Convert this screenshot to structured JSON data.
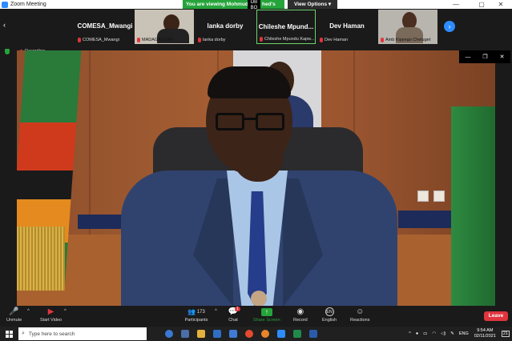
{
  "window": {
    "title": "Zoom Meeting",
    "controls": [
      "—",
      "▢",
      "✕"
    ]
  },
  "share_banner": {
    "viewing_left": "You are viewing Mohmud",
    "viewing_right": "hed's screen",
    "logo": "DB",
    "logo_bottom": "BO",
    "view_options": "View Options ▾"
  },
  "participants": [
    {
      "big": "COMESA_Mwangi",
      "small": "COMESA_Mwangi",
      "photo": false,
      "active": false
    },
    {
      "big": "",
      "small": "MADAGASCAR",
      "photo": true,
      "active": false
    },
    {
      "big": "lanka dorby",
      "small": "lanka dorby",
      "photo": false,
      "active": false
    },
    {
      "big": "Chileshe  Mpund...",
      "small": "Chileshe Mpundu Kapw...",
      "photo": false,
      "active": true
    },
    {
      "big": "Dev Haman",
      "small": "Dev Haman",
      "photo": false,
      "active": false
    },
    {
      "big": "",
      "small": "Amb Kipyego Cheluget",
      "photo": true,
      "active": false
    }
  ],
  "recording": {
    "label": "Recording..."
  },
  "toolbar": {
    "unmute": "Unmute",
    "start_video": "Start Video",
    "participants": "Participants",
    "participants_count": "173",
    "chat": "Chat",
    "chat_badge": "1",
    "share_screen": "Share Screen",
    "record": "Record",
    "english": "English",
    "english_icon": "EN",
    "reactions": "Reactions",
    "leave": "Leave"
  },
  "taskbar": {
    "search_placeholder": "Type here to search",
    "lang": "ENG",
    "time": "9:54 AM",
    "date": "02/11/2021",
    "notif": "21"
  },
  "colors": {
    "accent_green": "#25a43a",
    "leave_red": "#e0353e",
    "zoom_blue": "#2d8cff"
  }
}
